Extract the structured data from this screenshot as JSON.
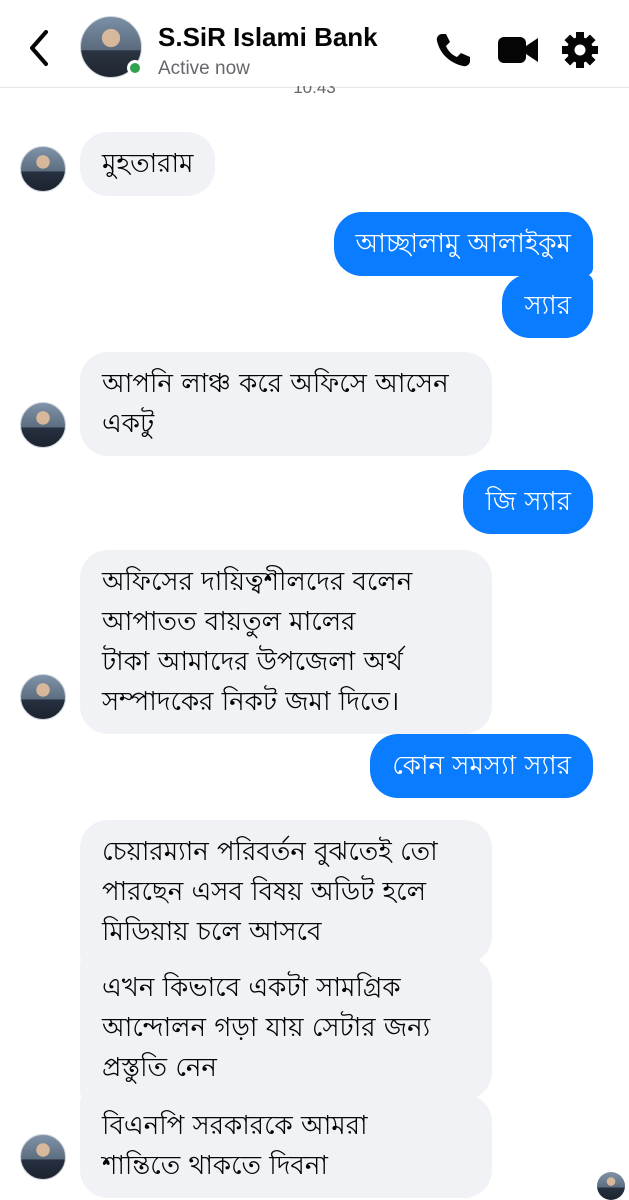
{
  "header": {
    "contact_name": "S.SiR Islami Bank",
    "status": "Active now",
    "icons": [
      "back-chevron-icon",
      "phone-icon",
      "video-camera-icon",
      "gear-icon"
    ],
    "accent": "#0a7cff",
    "online_color": "#31a24c"
  },
  "timestamp_partial": "10:43",
  "messages": [
    {
      "direction": "in",
      "text": "মুহতারাম"
    },
    {
      "direction": "out",
      "text": "আচ্ছালামু আলাইকুম"
    },
    {
      "direction": "out",
      "text": "স্যার"
    },
    {
      "direction": "in",
      "lines": [
        "আপনি লাঞ্চ করে অফিসে আসেন",
        "একটু"
      ]
    },
    {
      "direction": "out",
      "text": "জি স্যার"
    },
    {
      "direction": "in",
      "lines": [
        "অফিসের দায়িত্বশীলদের বলেন",
        "আপাতত বায়তুল মালের",
        "টাকা আমাদের উপজেলা অর্থ",
        "সম্পাদকের নিকট জমা দিতে।"
      ]
    },
    {
      "direction": "out",
      "text": "কোন সমস্যা স্যার"
    },
    {
      "direction": "in",
      "lines": [
        "চেয়ারম্যান পরিবর্তন বুঝতেই  তো",
        "পারছেন এসব বিষয় অডিট হলে",
        "মিডিয়ায় চলে আসবে"
      ]
    },
    {
      "direction": "in",
      "lines": [
        "এখন কিভাবে একটা সামগ্রিক",
        "আন্দোলন গড়া যায় সেটার জন্য",
        "প্রস্তুতি নেন"
      ]
    },
    {
      "direction": "in",
      "lines": [
        "বিএনপি সরকারকে আমরা",
        "শান্তিতে থাকতে দিবনা"
      ]
    }
  ]
}
